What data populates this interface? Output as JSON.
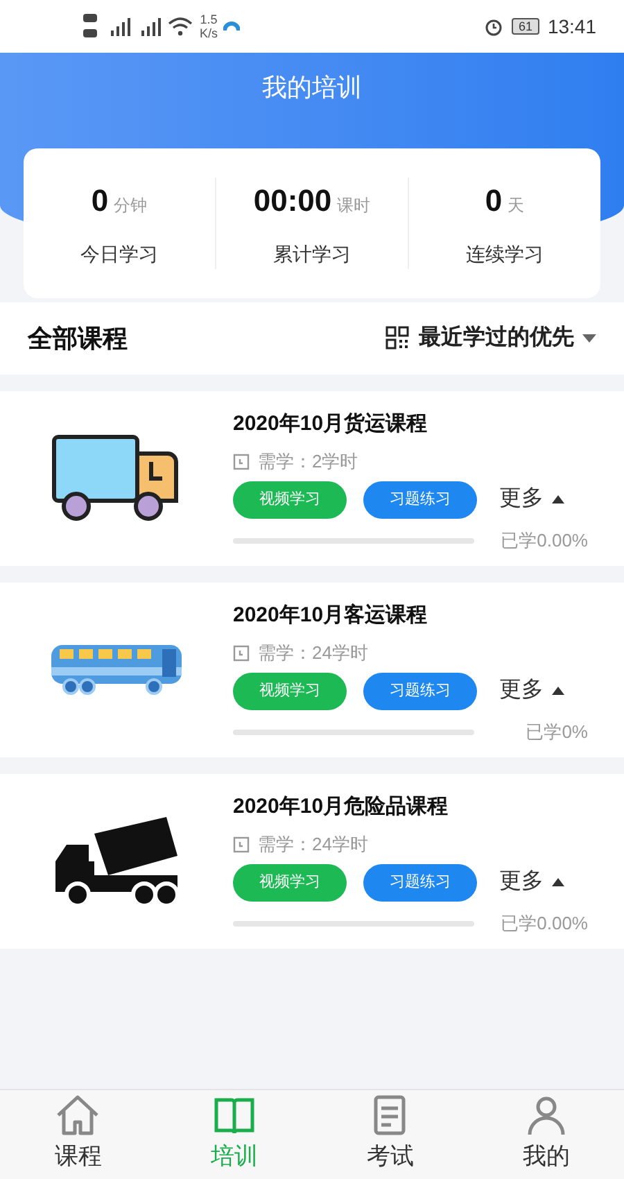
{
  "status_bar": {
    "speed": "1.5",
    "speed_unit": "K/s",
    "battery": "61",
    "time": "13:41"
  },
  "header": {
    "title": "我的培训"
  },
  "stats": [
    {
      "value": "0",
      "unit": "分钟",
      "label": "今日学习"
    },
    {
      "value": "00:00",
      "unit": "课时",
      "label": "累计学习"
    },
    {
      "value": "0",
      "unit": "天",
      "label": "连续学习"
    }
  ],
  "section": {
    "title": "全部课程",
    "sort": "最近学过的优先"
  },
  "courses": [
    {
      "kind": "truck",
      "title": "2020年10月货运课程",
      "required": "需学：2学时",
      "video_button": "视频学习",
      "quiz_button": "习题练习",
      "more": "更多",
      "level": 0,
      "progress": "已学0.00%"
    },
    {
      "kind": "bus",
      "title": "2020年10月客运课程",
      "required": "需学：24学时",
      "video_button": "视频学习",
      "quiz_button": "习题练习",
      "more": "更多",
      "level": 0,
      "progress": "已学0%"
    },
    {
      "kind": "mixer",
      "title": "2020年10月危险品课程",
      "required": "需学：24学时",
      "video_button": "视频学习",
      "quiz_button": "习题练习",
      "more": "更多",
      "level": 0,
      "progress": "已学0.00%"
    }
  ],
  "tabs": [
    {
      "kind": "home",
      "label": "课程",
      "selected": false
    },
    {
      "kind": "book",
      "label": "培训",
      "selected": true
    },
    {
      "kind": "paper",
      "label": "考试",
      "selected": false
    },
    {
      "kind": "person",
      "label": "我的",
      "selected": false
    }
  ]
}
